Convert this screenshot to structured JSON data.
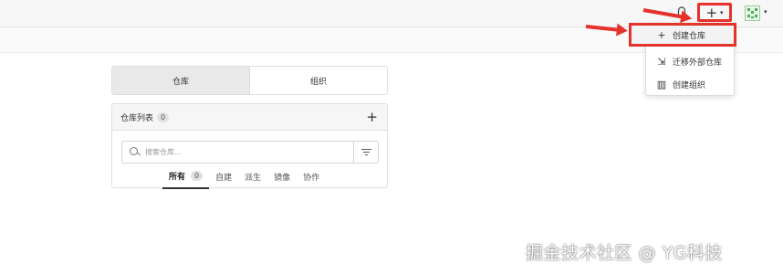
{
  "header": {
    "notify_icon": "bell-icon",
    "create_button": "+",
    "create_caret": "▾",
    "avatar_caret": "▾",
    "accent_color": "#e5322d"
  },
  "create_menu": {
    "items": [
      {
        "icon": "plus-icon",
        "glyph": "+",
        "label": "创建仓库"
      },
      {
        "icon": "migrate-icon",
        "glyph": "⇲",
        "label": "迁移外部仓库"
      },
      {
        "icon": "organization-icon",
        "glyph": "▥",
        "label": "创建组织"
      }
    ]
  },
  "segment": {
    "tabs": [
      "仓库",
      "组织"
    ],
    "active_index": 0
  },
  "repo_panel": {
    "title": "仓库列表",
    "count": "0",
    "add_button": "+",
    "search_placeholder": "搜索仓库...",
    "filters": [
      {
        "label": "所有",
        "count": "0",
        "active": true
      },
      {
        "label": "自建"
      },
      {
        "label": "派生"
      },
      {
        "label": "镜像"
      },
      {
        "label": "协作"
      }
    ]
  },
  "watermark": "掘金技术社区 @ YG科技"
}
